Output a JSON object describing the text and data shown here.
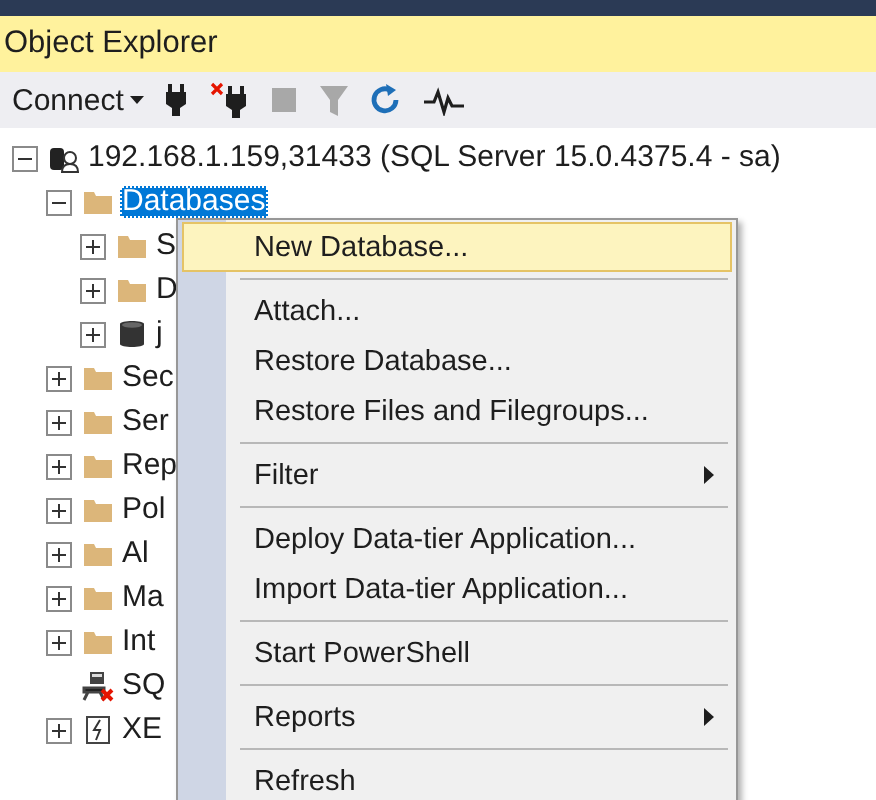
{
  "panel": {
    "title": "Object Explorer"
  },
  "toolbar": [
    {
      "kind": "connect",
      "label": "Connect",
      "disabled": false
    },
    {
      "kind": "plug",
      "disabled": false
    },
    {
      "kind": "disconnect",
      "disabled": false
    },
    {
      "kind": "stop",
      "disabled": true
    },
    {
      "kind": "filter",
      "disabled": true
    },
    {
      "kind": "refresh",
      "disabled": false
    },
    {
      "kind": "activity",
      "disabled": false
    }
  ],
  "tree": [
    {
      "label": "192.168.1.159,31433 (SQL Server 15.0.4375.4 - sa)",
      "kind": "server",
      "expanded": true,
      "selected": false,
      "children": [
        {
          "label": "Databases",
          "kind": "folder",
          "expanded": true,
          "selected": true,
          "children": [
            {
              "label": "S",
              "kind": "folder",
              "expanded": false,
              "selected": false
            },
            {
              "label": "D",
              "kind": "folder",
              "expanded": false,
              "selected": false
            },
            {
              "label": "j",
              "kind": "database",
              "expanded": false,
              "selected": false
            }
          ]
        },
        {
          "label": "Sec",
          "kind": "folder",
          "expanded": false,
          "selected": false
        },
        {
          "label": "Ser",
          "kind": "folder",
          "expanded": false,
          "selected": false
        },
        {
          "label": "Rep",
          "kind": "folder",
          "expanded": false,
          "selected": false
        },
        {
          "label": "Pol",
          "kind": "folder",
          "expanded": false,
          "selected": false
        },
        {
          "label": "Al",
          "kind": "folder",
          "expanded": false,
          "selected": false
        },
        {
          "label": "Ma",
          "kind": "folder",
          "expanded": false,
          "selected": false
        },
        {
          "label": "Int",
          "kind": "folder",
          "expanded": false,
          "selected": false
        },
        {
          "label": "SQ",
          "kind": "agent",
          "expandable": false,
          "selected": false
        },
        {
          "label": "XE",
          "kind": "xevent",
          "expanded": false,
          "selected": false
        }
      ]
    }
  ],
  "context_menu": [
    {
      "kind": "item",
      "label": "New Database...",
      "submenu": false,
      "selected": true
    },
    {
      "kind": "separator"
    },
    {
      "kind": "item",
      "label": "Attach...",
      "submenu": false,
      "selected": false
    },
    {
      "kind": "item",
      "label": "Restore Database...",
      "submenu": false,
      "selected": false
    },
    {
      "kind": "item",
      "label": "Restore Files and Filegroups...",
      "submenu": false,
      "selected": false
    },
    {
      "kind": "separator"
    },
    {
      "kind": "item",
      "label": "Filter",
      "submenu": true,
      "selected": false
    },
    {
      "kind": "separator"
    },
    {
      "kind": "item",
      "label": "Deploy Data-tier Application...",
      "submenu": false,
      "selected": false
    },
    {
      "kind": "item",
      "label": "Import Data-tier Application...",
      "submenu": false,
      "selected": false
    },
    {
      "kind": "separator"
    },
    {
      "kind": "item",
      "label": "Start PowerShell",
      "submenu": false,
      "selected": false
    },
    {
      "kind": "separator"
    },
    {
      "kind": "item",
      "label": "Reports",
      "submenu": true,
      "selected": false
    },
    {
      "kind": "separator"
    },
    {
      "kind": "item",
      "label": "Refresh",
      "submenu": false,
      "selected": false
    }
  ]
}
